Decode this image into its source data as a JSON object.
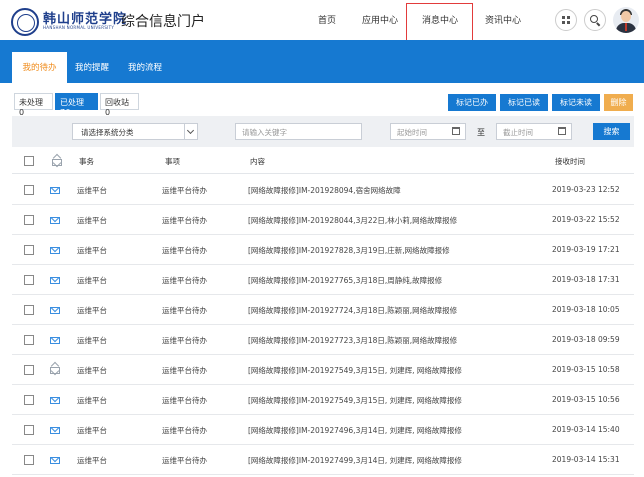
{
  "header": {
    "logo_cn": "韩山师范学院",
    "logo_en": "HANSHAN NORMAL UNIVERSITY",
    "portal_title": "综合信息门户",
    "nav": [
      {
        "label": "首页"
      },
      {
        "label": "应用中心"
      },
      {
        "label": "消息中心"
      },
      {
        "label": "资讯中心"
      }
    ]
  },
  "subtabs": [
    {
      "label": "我的待办"
    },
    {
      "label": "我的提醒"
    },
    {
      "label": "我的流程"
    }
  ],
  "status_filters": [
    {
      "label": "未处理 0"
    },
    {
      "label": "已处理 76"
    },
    {
      "label": "回收站 0"
    }
  ],
  "actions": [
    {
      "label": "标记已办",
      "color": "#1679d1"
    },
    {
      "label": "标记已读",
      "color": "#1679d1"
    },
    {
      "label": "标记未读",
      "color": "#1679d1"
    },
    {
      "label": "删除",
      "color": "#f0ad4e"
    }
  ],
  "filters": {
    "category_select": "请选择系统分类",
    "keyword_placeholder": "请输入关键字",
    "start_placeholder": "起始时间",
    "to_label": "至",
    "end_placeholder": "截止时间",
    "search_label": "搜索"
  },
  "table": {
    "headers": {
      "affair": "事务",
      "item": "事项",
      "content": "内容",
      "time": "接收时间"
    },
    "rows": [
      {
        "affair": "运维平台",
        "item": "运维平台待办",
        "content": "[网络故障报修]IM-201928094,宿舍网络故障",
        "time": "2019-03-23 12:52",
        "read": false
      },
      {
        "affair": "运维平台",
        "item": "运维平台待办",
        "content": "[网络故障报修]IM-201928044,3月22日,林小莉,网络故障报修",
        "time": "2019-03-22 15:52",
        "read": false
      },
      {
        "affair": "运维平台",
        "item": "运维平台待办",
        "content": "[网络故障报修]IM-201927828,3月19日,庄新,网络故障报修",
        "time": "2019-03-19 17:21",
        "read": false
      },
      {
        "affair": "运维平台",
        "item": "运维平台待办",
        "content": "[网络故障报修]IM-201927765,3月18日,周静纯,故障报修",
        "time": "2019-03-18 17:31",
        "read": false
      },
      {
        "affair": "运维平台",
        "item": "运维平台待办",
        "content": "[网络故障报修]IM-201927724,3月18日,陈颖丽,网络故障报修",
        "time": "2019-03-18 10:05",
        "read": false
      },
      {
        "affair": "运维平台",
        "item": "运维平台待办",
        "content": "[网络故障报修]IM-201927723,3月18日,陈颖丽,网络故障报修",
        "time": "2019-03-18 09:59",
        "read": false
      },
      {
        "affair": "运维平台",
        "item": "运维平台待办",
        "content": "[网络故障报修]IM-201927549,3月15日, 刘建辉, 网络故障报修",
        "time": "2019-03-15 10:58",
        "read": true
      },
      {
        "affair": "运维平台",
        "item": "运维平台待办",
        "content": "[网络故障报修]IM-201927549,3月15日, 刘建辉, 网络故障报修",
        "time": "2019-03-15 10:56",
        "read": false
      },
      {
        "affair": "运维平台",
        "item": "运维平台待办",
        "content": "[网络故障报修]IM-201927496,3月14日, 刘建辉, 网络故障报修",
        "time": "2019-03-14 15:40",
        "read": false
      },
      {
        "affair": "运维平台",
        "item": "运维平台待办",
        "content": "[网络故障报修]IM-201927499,3月14日, 刘建辉, 网络故障报修",
        "time": "2019-03-14 15:31",
        "read": false
      }
    ]
  }
}
